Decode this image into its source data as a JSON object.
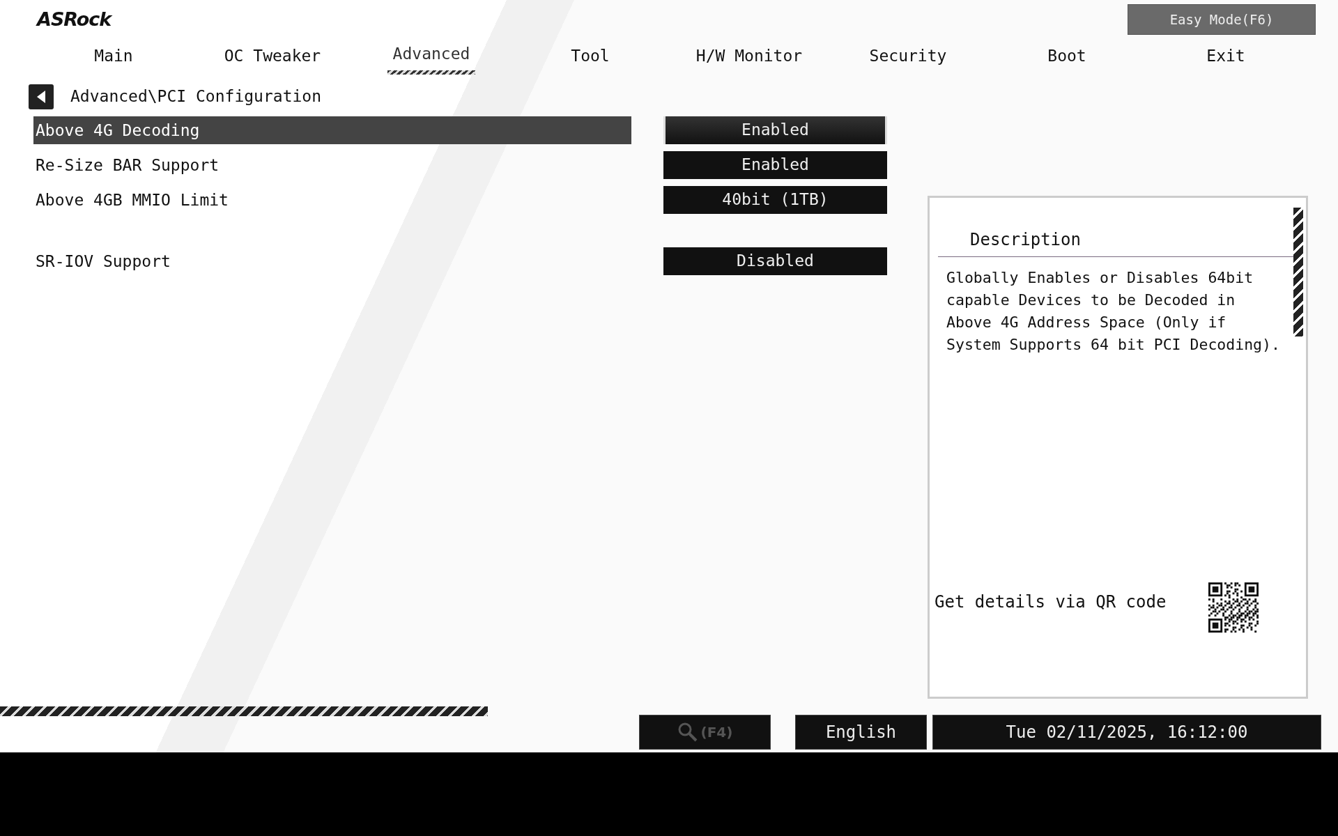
{
  "logo": "ASRock",
  "easy_mode_button": "Easy Mode(F6)",
  "tabs": [
    {
      "label": "Main",
      "selected": false
    },
    {
      "label": "OC Tweaker",
      "selected": false
    },
    {
      "label": "Advanced",
      "selected": true
    },
    {
      "label": "Tool",
      "selected": false
    },
    {
      "label": "H/W Monitor",
      "selected": false
    },
    {
      "label": "Security",
      "selected": false
    },
    {
      "label": "Boot",
      "selected": false
    },
    {
      "label": "Exit",
      "selected": false
    }
  ],
  "breadcrumb": "Advanced\\PCI Configuration",
  "settings": [
    {
      "label": "Above 4G Decoding",
      "value": "Enabled",
      "selected": true,
      "separated": false
    },
    {
      "label": "Re-Size BAR Support",
      "value": "Enabled",
      "selected": false,
      "separated": false
    },
    {
      "label": "Above 4GB MMIO Limit",
      "value": "40bit (1TB)",
      "selected": false,
      "separated": false
    },
    {
      "label": "SR-IOV Support",
      "value": "Disabled",
      "selected": false,
      "separated": true
    }
  ],
  "description": {
    "title": "Description",
    "text": "Globally Enables or Disables 64bit capable Devices to be Decoded in Above 4G Address Space (Only if System Supports 64 bit PCI Decoding).",
    "qr_caption": "Get details via QR code"
  },
  "status_bar": {
    "search": "(F4)",
    "language": "English",
    "datetime": "Tue 02/11/2025, 16:12:00"
  }
}
